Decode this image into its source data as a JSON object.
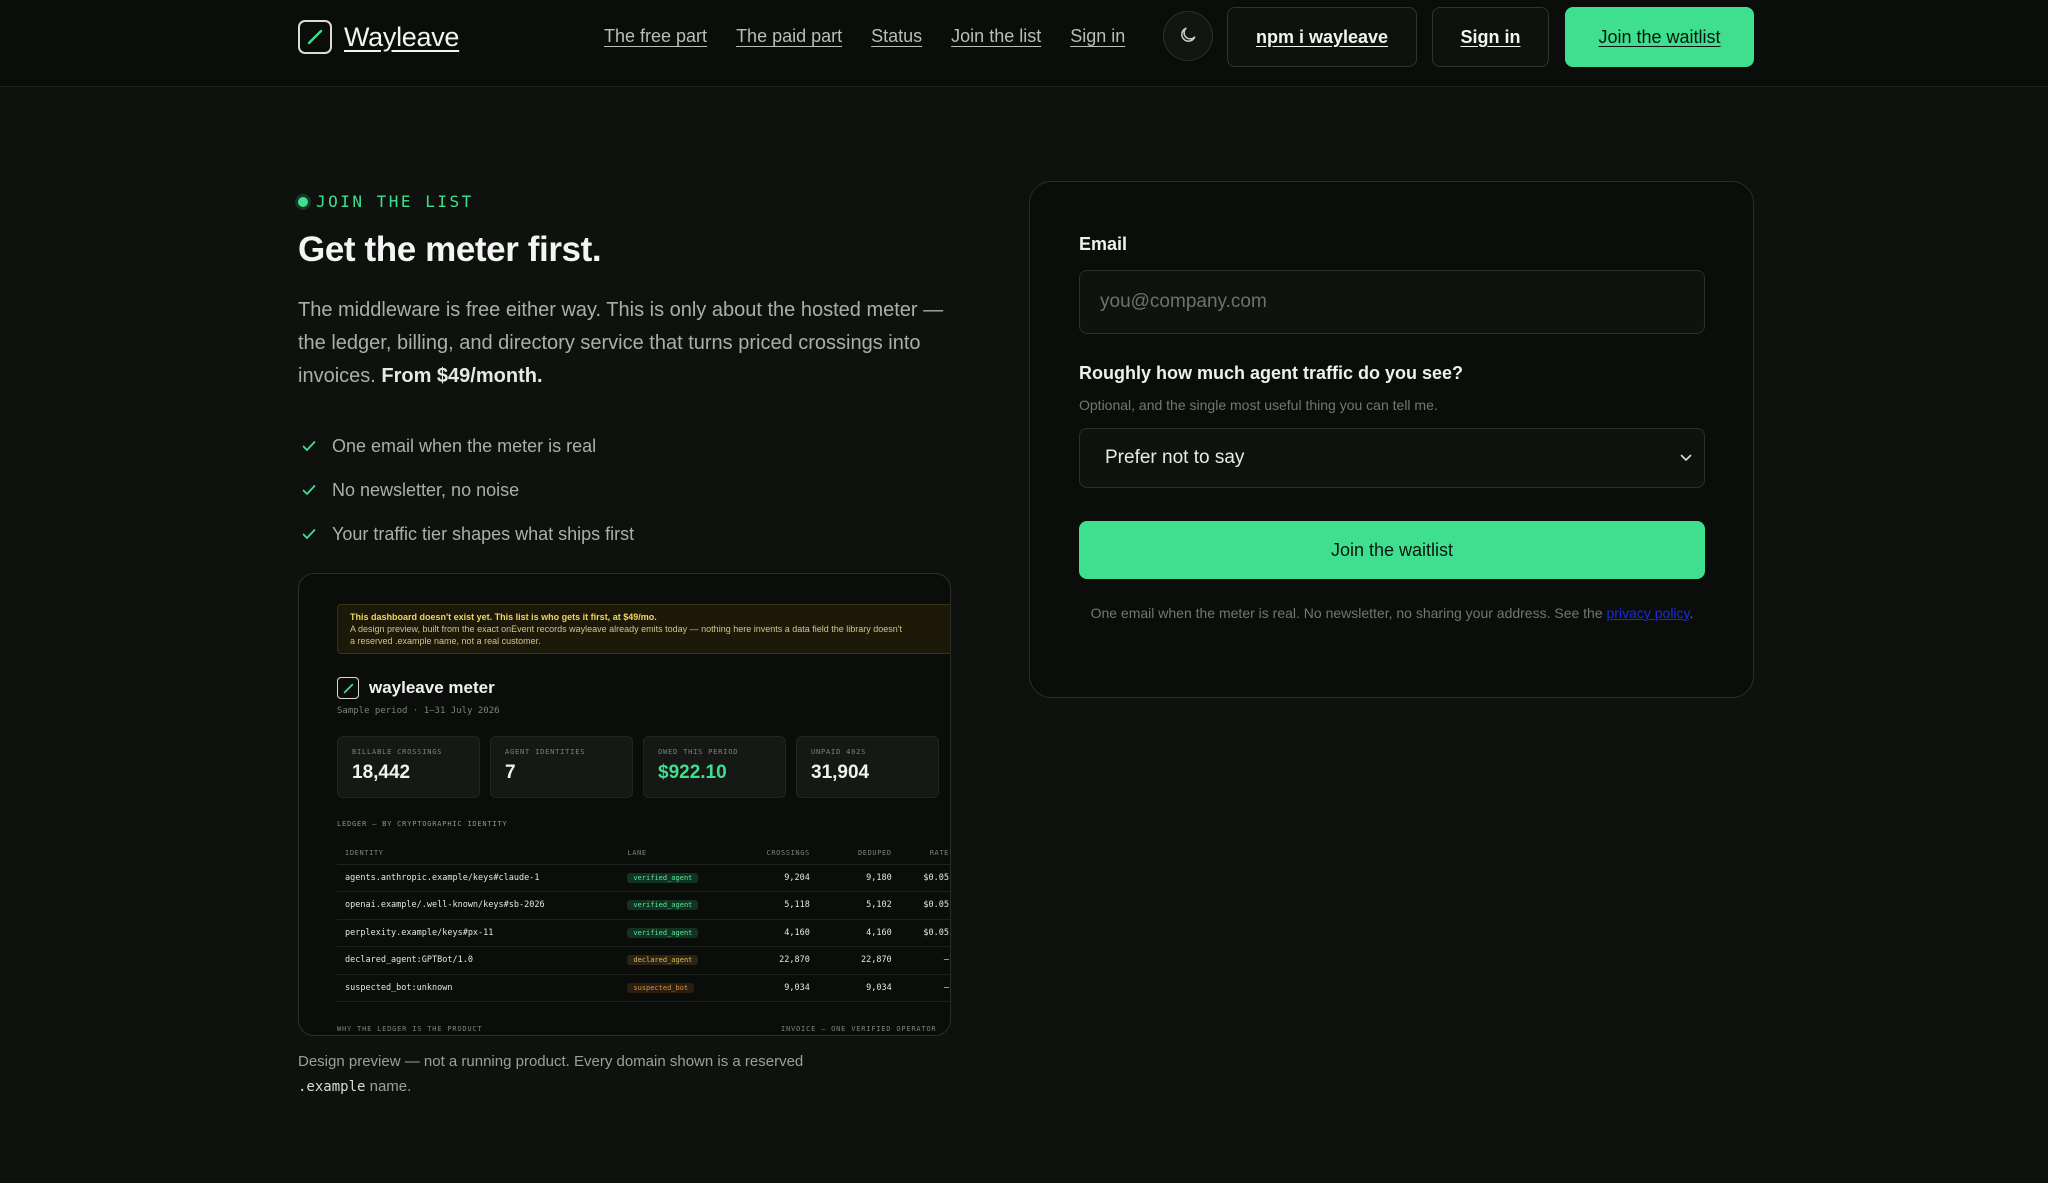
{
  "header": {
    "brand": "Wayleave",
    "nav": [
      "The free part",
      "The paid part",
      "Status",
      "Join the list",
      "Sign in"
    ],
    "npm_button": "npm i wayleave",
    "signin_button": "Sign in",
    "waitlist_button": "Join the waitlist"
  },
  "intro": {
    "eyebrow": "JOIN THE LIST",
    "headline": "Get the meter first.",
    "lede": "The middleware is free either way. This is only about the hosted meter — the ledger, billing, and directory service that turns priced crossings into invoices.",
    "lede_price": "From $49/month.",
    "checks": [
      "One email when the meter is real",
      "No newsletter, no noise",
      "Your traffic tier shapes what ships first"
    ]
  },
  "preview": {
    "banner_title": "This dashboard doesn't exist yet. This list is who gets it first, at $49/mo.",
    "banner_line2": "A design preview, built from the exact onEvent records wayleave already emits today — nothing here invents a data field the library doesn't",
    "banner_line3": "a reserved .example name, not a real customer.",
    "title": "wayleave meter",
    "subtitle": "Sample period · 1–31 July 2026",
    "stats": [
      {
        "label": "BILLABLE CROSSINGS",
        "value": "18,442"
      },
      {
        "label": "AGENT IDENTITIES",
        "value": "7"
      },
      {
        "label": "OWED THIS PERIOD",
        "value": "$922.10"
      },
      {
        "label": "UNPAID 402S",
        "value": "31,904"
      }
    ],
    "ledger_title": "LEDGER — BY CRYPTOGRAPHIC IDENTITY",
    "columns": [
      "IDENTITY",
      "LANE",
      "CROSSINGS",
      "DEDUPED",
      "RATE"
    ],
    "rows": [
      {
        "identity": "agents.anthropic.example/keys#claude-1",
        "lane": "verified_agent",
        "crossings": "9,204",
        "deduped": "9,180",
        "rate": "$0.05"
      },
      {
        "identity": "openai.example/.well-known/keys#sb-2026",
        "lane": "verified_agent",
        "crossings": "5,118",
        "deduped": "5,102",
        "rate": "$0.05"
      },
      {
        "identity": "perplexity.example/keys#px-11",
        "lane": "verified_agent",
        "crossings": "4,160",
        "deduped": "4,160",
        "rate": "$0.05"
      },
      {
        "identity": "declared_agent:GPTBot/1.0",
        "lane": "declared_agent",
        "crossings": "22,870",
        "deduped": "22,870",
        "rate": "—"
      },
      {
        "identity": "suspected_bot:unknown",
        "lane": "suspected_bot",
        "crossings": "9,034",
        "deduped": "9,034",
        "rate": "—"
      }
    ],
    "footer_left": "WHY THE LEDGER IS THE PRODUCT",
    "footer_right": "INVOICE — ONE VERIFIED OPERATOR",
    "caption": "Design preview — not a running product. Every domain shown is a reserved",
    "caption_code": ".example",
    "caption_end": "name."
  },
  "form": {
    "email_label": "Email",
    "email_placeholder": "you@company.com",
    "traffic_label": "Roughly how much agent traffic do you see?",
    "traffic_hint": "Optional, and the single most useful thing you can tell me.",
    "traffic_value": "Prefer not to say",
    "submit": "Join the waitlist",
    "legal": "One email when the meter is real. No newsletter, no sharing your address. See the",
    "legal_link": "privacy policy",
    "legal_end": "."
  },
  "colors": {
    "accent": "#3ee08f",
    "background": "#0f110f",
    "card": "#0b0d0b"
  }
}
